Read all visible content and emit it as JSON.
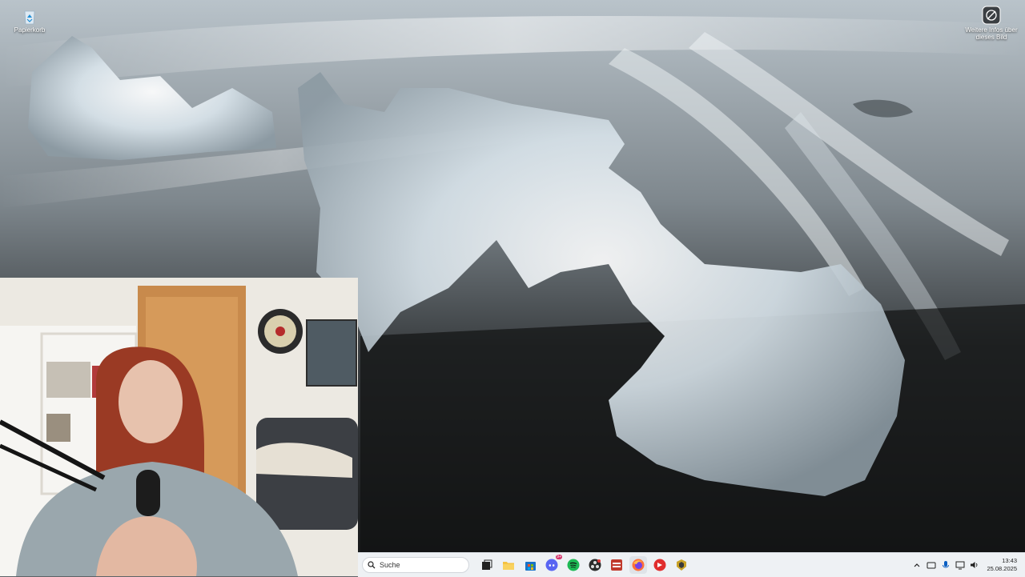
{
  "desktop": {
    "recycle_bin_label": "Papierkorb",
    "wallpaper_info_label": "Weitere Infos über dieses Bild"
  },
  "taskbar": {
    "search_placeholder": "Suche",
    "apps": [
      {
        "name": "task-view",
        "icon": "task-view-icon"
      },
      {
        "name": "file-explorer",
        "icon": "folder-icon"
      },
      {
        "name": "store",
        "icon": "store-icon"
      },
      {
        "name": "discord",
        "icon": "discord-icon",
        "badge": "9+"
      },
      {
        "name": "spotify",
        "icon": "spotify-icon"
      },
      {
        "name": "obs",
        "icon": "obs-icon"
      },
      {
        "name": "streamer-bot",
        "icon": "app-icon"
      },
      {
        "name": "firefox",
        "icon": "firefox-icon",
        "active": true
      },
      {
        "name": "app-red",
        "icon": "app-icon"
      },
      {
        "name": "app-gold",
        "icon": "app-icon"
      }
    ],
    "tray": {
      "time": "13:43",
      "date": "25.08.2025"
    }
  },
  "colors": {
    "taskbar_bg": "#eef1f4",
    "accent_blue": "#0a5fc2"
  }
}
